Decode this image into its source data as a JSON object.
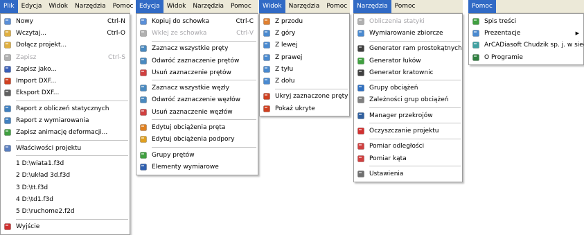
{
  "panels": [
    {
      "menubar": [
        "Plik",
        "Edycja",
        "Widok",
        "Narzędzia",
        "Pomoc"
      ],
      "selected": 0,
      "items": [
        {
          "label": "Nowy",
          "shortcut": "Ctrl-N",
          "icon": "new-file-icon",
          "color": "#5a8fd8"
        },
        {
          "label": "Wczytaj...",
          "shortcut": "Ctrl-O",
          "icon": "open-folder-icon",
          "color": "#e0b040"
        },
        {
          "label": "Dołącz projekt...",
          "icon": "append-folder-icon",
          "color": "#e0b040"
        },
        {
          "label": "Zapisz",
          "shortcut": "Ctrl-S",
          "icon": "save-icon",
          "color": "#b0b0b0",
          "disabled": true
        },
        {
          "label": "Zapisz jako...",
          "icon": "save-as-icon",
          "color": "#3a5fb8"
        },
        {
          "label": "Import DXF...",
          "icon": "import-dxf-icon",
          "color": "#d04020"
        },
        {
          "label": "Eksport DXF...",
          "icon": "export-dxf-icon",
          "color": "#606060"
        },
        {
          "sep": true
        },
        {
          "label": "Raport z obliczeń statycznych",
          "icon": "report-icon",
          "color": "#4080c0"
        },
        {
          "label": "Raport z wymiarowania",
          "icon": "report-icon",
          "color": "#4080c0"
        },
        {
          "label": "Zapisz animację deformacji...",
          "icon": "animation-icon",
          "color": "#40a040"
        },
        {
          "sep": true
        },
        {
          "label": "Właściwości projektu",
          "icon": "properties-icon",
          "color": "#5a7fc0"
        },
        {
          "sep": true
        },
        {
          "label": "1 D:\\wiata1.f3d",
          "recent": true
        },
        {
          "label": "2 D:\\układ 3d.f3d",
          "recent": true
        },
        {
          "label": "3 D:\\tt.f3d",
          "recent": true
        },
        {
          "label": "4 D:\\td1.f3d",
          "recent": true
        },
        {
          "label": "5 D:\\ruchome2.f2d",
          "recent": true
        },
        {
          "sep": true
        },
        {
          "label": "Wyjście",
          "icon": "exit-icon",
          "color": "#d03030"
        }
      ]
    },
    {
      "menubar": [
        "Edycja",
        "Widok",
        "Narzędzia",
        "Pomoc"
      ],
      "selected": 0,
      "items": [
        {
          "label": "Kopiuj do schowka",
          "shortcut": "Ctrl-C",
          "icon": "copy-icon",
          "color": "#5a8fd8"
        },
        {
          "label": "Wklej ze schowka",
          "shortcut": "Ctrl-V",
          "icon": "paste-icon",
          "color": "#b0b0b0",
          "disabled": true
        },
        {
          "sep": true
        },
        {
          "label": "Zaznacz wszystkie pręty",
          "icon": "select-all-bars-icon",
          "color": "#4a8ac0"
        },
        {
          "label": "Odwróć zaznaczenie prętów",
          "icon": "invert-bars-icon",
          "color": "#4a8ac0"
        },
        {
          "label": "Usuń zaznaczenie prętów",
          "icon": "deselect-bars-icon",
          "color": "#d04040"
        },
        {
          "sep": true
        },
        {
          "label": "Zaznacz wszystkie węzły",
          "icon": "select-all-nodes-icon",
          "color": "#4a8ac0"
        },
        {
          "label": "Odwróć zaznaczenie węzłów",
          "icon": "invert-nodes-icon",
          "color": "#4a8ac0"
        },
        {
          "label": "Usuń zaznaczenie węzłów",
          "icon": "deselect-nodes-icon",
          "color": "#d04040"
        },
        {
          "sep": true
        },
        {
          "label": "Edytuj obciążenia pręta",
          "icon": "bar-load-icon",
          "color": "#e08020"
        },
        {
          "label": "Edytuj obciążenia podpory",
          "icon": "support-load-icon",
          "color": "#e0a020"
        },
        {
          "sep": true
        },
        {
          "label": "Grupy prętów",
          "icon": "bar-groups-icon",
          "color": "#40a040"
        },
        {
          "label": "Elementy wymiarowe",
          "icon": "dimension-icon",
          "color": "#3060b0"
        }
      ]
    },
    {
      "menubar": [
        "Widok",
        "Narzędzia",
        "Pomoc"
      ],
      "selected": 0,
      "items": [
        {
          "label": "Z przodu",
          "icon": "view-front-icon",
          "color": "#e08030"
        },
        {
          "label": "Z góry",
          "icon": "view-top-icon",
          "color": "#4a8ad0"
        },
        {
          "label": "Z lewej",
          "icon": "view-left-icon",
          "color": "#4a8ad0"
        },
        {
          "label": "Z prawej",
          "icon": "view-right-icon",
          "color": "#4a8ad0"
        },
        {
          "label": "Z tyłu",
          "icon": "view-back-icon",
          "color": "#4a8ad0"
        },
        {
          "label": "Z dołu",
          "icon": "view-bottom-icon",
          "color": "#4a8ad0"
        },
        {
          "sep": true
        },
        {
          "label": "Ukryj zaznaczone pręty",
          "icon": "hide-bars-icon",
          "color": "#d04020"
        },
        {
          "label": "Pokaż ukryte",
          "icon": "show-hidden-icon",
          "color": "#d04020"
        }
      ]
    },
    {
      "menubar": [
        "Narzędzia",
        "Pomoc"
      ],
      "selected": 0,
      "items": [
        {
          "label": "Obliczenia statyki",
          "icon": "calc-icon",
          "color": "#b0b0b0",
          "disabled": true
        },
        {
          "label": "Wymiarowanie zbiorcze",
          "icon": "batch-dimension-icon",
          "color": "#4a8ad0"
        },
        {
          "sep": true
        },
        {
          "label": "Generator ram prostokątnych",
          "icon": "frame-generator-icon",
          "color": "#404040"
        },
        {
          "label": "Generator łuków",
          "icon": "arc-generator-icon",
          "color": "#40a040"
        },
        {
          "label": "Generator kratownic",
          "icon": "truss-generator-icon",
          "color": "#404040"
        },
        {
          "sep": true
        },
        {
          "label": "Grupy obciążeń",
          "icon": "load-groups-icon",
          "color": "#3070c0"
        },
        {
          "label": "Zależności grup obciążeń",
          "icon": "load-deps-icon",
          "color": "#808080"
        },
        {
          "sep": true
        },
        {
          "label": "Manager przekrojów",
          "icon": "section-manager-icon",
          "color": "#3060a0"
        },
        {
          "sep": true
        },
        {
          "label": "Oczyszczanie projektu",
          "icon": "cleanup-icon",
          "color": "#d03030"
        },
        {
          "sep": true
        },
        {
          "label": "Pomiar odległości",
          "icon": "measure-distance-icon",
          "color": "#d04040"
        },
        {
          "label": "Pomiar kąta",
          "icon": "measure-angle-icon",
          "color": "#d04040"
        },
        {
          "sep": true
        },
        {
          "label": "Ustawienia",
          "icon": "settings-icon",
          "color": "#707070"
        }
      ]
    },
    {
      "menubar": [
        "Pomoc"
      ],
      "selected": 0,
      "items": [
        {
          "label": "Spis treści",
          "icon": "help-contents-icon",
          "color": "#40a040"
        },
        {
          "label": "Prezentacje",
          "icon": "presentations-icon",
          "color": "#4a8ad0",
          "submenu": true
        },
        {
          "label": "ArCADiasoft Chudzik sp. j. w sieci",
          "icon": "web-icon",
          "color": "#40a0a0"
        },
        {
          "label": "O Programie",
          "icon": "about-icon",
          "color": "#308040"
        }
      ]
    }
  ]
}
